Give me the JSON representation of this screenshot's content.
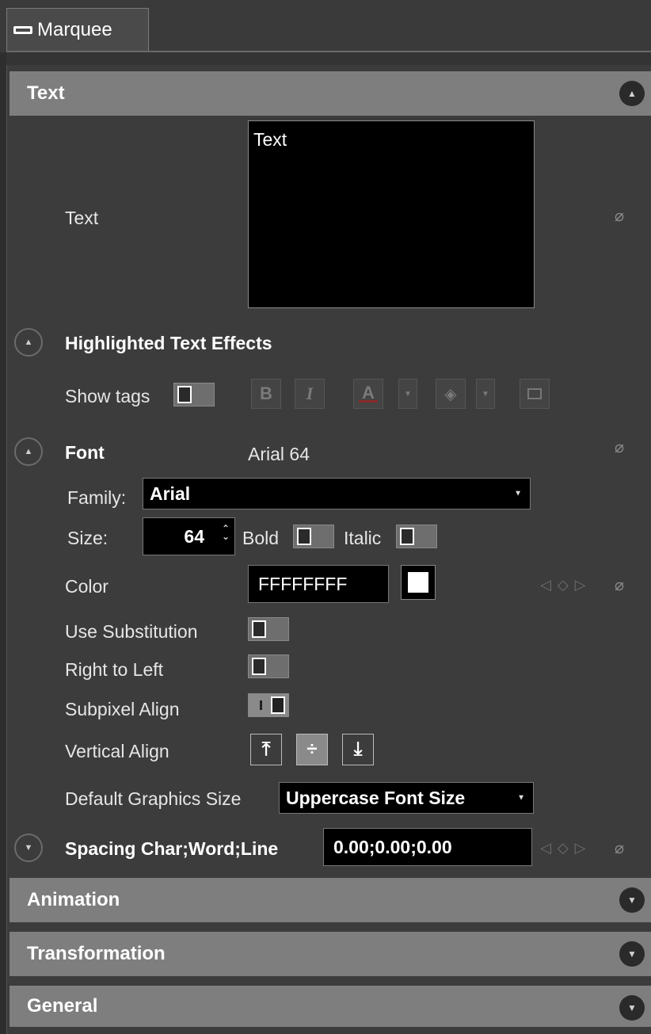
{
  "tab": {
    "label": "Marquee",
    "icon": "marquee-icon"
  },
  "sections": {
    "text": {
      "label": "Text"
    },
    "animation": {
      "label": "Animation"
    },
    "transformation": {
      "label": "Transformation"
    },
    "general": {
      "label": "General"
    }
  },
  "text_field": {
    "label": "Text",
    "value": "Text"
  },
  "highlighted": {
    "label": "Highlighted Text Effects",
    "show_tags_label": "Show tags",
    "bold_glyph": "B",
    "italic_glyph": "I",
    "font_color_glyph": "A"
  },
  "font": {
    "label": "Font",
    "summary": "Arial 64",
    "family_label": "Family:",
    "family_value": "Arial",
    "size_label": "Size:",
    "size_value": "64",
    "bold_label": "Bold",
    "italic_label": "Italic"
  },
  "color": {
    "label": "Color",
    "value": "FFFFFFFF",
    "swatch": "#FFFFFF"
  },
  "use_substitution": {
    "label": "Use Substitution"
  },
  "right_to_left": {
    "label": "Right to Left"
  },
  "subpixel_align": {
    "label": "Subpixel Align"
  },
  "vertical_align": {
    "label": "Vertical Align"
  },
  "default_graphics_size": {
    "label": "Default Graphics Size",
    "value": "Uppercase Font Size"
  },
  "spacing": {
    "label": "Spacing Char;Word;Line",
    "value": "0.00;0.00;0.00"
  }
}
